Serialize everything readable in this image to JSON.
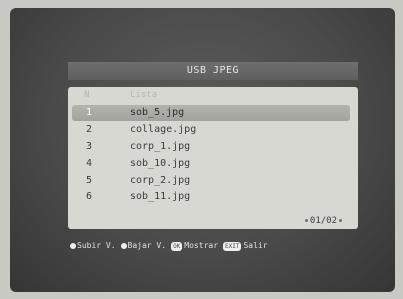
{
  "title": "USB JPEG",
  "table": {
    "headers": {
      "number": "N",
      "list": "Lista"
    },
    "rows": [
      {
        "num": "1",
        "name": "sob_5.jpg"
      },
      {
        "num": "2",
        "name": "collage.jpg"
      },
      {
        "num": "3",
        "name": "corp_1.jpg"
      },
      {
        "num": "4",
        "name": "sob_10.jpg"
      },
      {
        "num": "5",
        "name": "corp_2.jpg"
      },
      {
        "num": "6",
        "name": "sob_11.jpg"
      }
    ],
    "selected_index": 0
  },
  "page_indicator": "01/02",
  "footer": {
    "subir_label": "Subir V.",
    "bajar_label": "Bajar V.",
    "ok_key": "OK",
    "mostrar_label": "Mostrar",
    "exit_key": "EXIT",
    "salir_label": "Salir"
  },
  "colors": {
    "screen_bg": "#4a4a4a",
    "panel_bg": "#d8d8d2",
    "selected_row": "#a8a8a2"
  }
}
